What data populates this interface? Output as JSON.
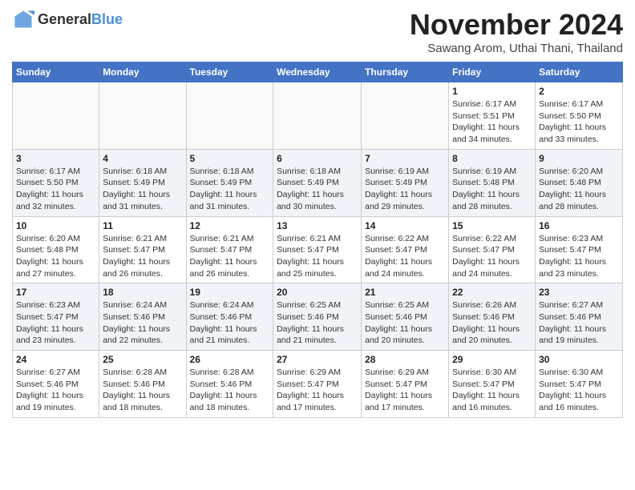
{
  "header": {
    "logo_general": "General",
    "logo_blue": "Blue",
    "month_title": "November 2024",
    "subtitle": "Sawang Arom, Uthai Thani, Thailand"
  },
  "days_of_week": [
    "Sunday",
    "Monday",
    "Tuesday",
    "Wednesday",
    "Thursday",
    "Friday",
    "Saturday"
  ],
  "weeks": [
    [
      {
        "day": "",
        "info": ""
      },
      {
        "day": "",
        "info": ""
      },
      {
        "day": "",
        "info": ""
      },
      {
        "day": "",
        "info": ""
      },
      {
        "day": "",
        "info": ""
      },
      {
        "day": "1",
        "info": "Sunrise: 6:17 AM\nSunset: 5:51 PM\nDaylight: 11 hours and 34 minutes."
      },
      {
        "day": "2",
        "info": "Sunrise: 6:17 AM\nSunset: 5:50 PM\nDaylight: 11 hours and 33 minutes."
      }
    ],
    [
      {
        "day": "3",
        "info": "Sunrise: 6:17 AM\nSunset: 5:50 PM\nDaylight: 11 hours and 32 minutes."
      },
      {
        "day": "4",
        "info": "Sunrise: 6:18 AM\nSunset: 5:49 PM\nDaylight: 11 hours and 31 minutes."
      },
      {
        "day": "5",
        "info": "Sunrise: 6:18 AM\nSunset: 5:49 PM\nDaylight: 11 hours and 31 minutes."
      },
      {
        "day": "6",
        "info": "Sunrise: 6:18 AM\nSunset: 5:49 PM\nDaylight: 11 hours and 30 minutes."
      },
      {
        "day": "7",
        "info": "Sunrise: 6:19 AM\nSunset: 5:49 PM\nDaylight: 11 hours and 29 minutes."
      },
      {
        "day": "8",
        "info": "Sunrise: 6:19 AM\nSunset: 5:48 PM\nDaylight: 11 hours and 28 minutes."
      },
      {
        "day": "9",
        "info": "Sunrise: 6:20 AM\nSunset: 5:48 PM\nDaylight: 11 hours and 28 minutes."
      }
    ],
    [
      {
        "day": "10",
        "info": "Sunrise: 6:20 AM\nSunset: 5:48 PM\nDaylight: 11 hours and 27 minutes."
      },
      {
        "day": "11",
        "info": "Sunrise: 6:21 AM\nSunset: 5:47 PM\nDaylight: 11 hours and 26 minutes."
      },
      {
        "day": "12",
        "info": "Sunrise: 6:21 AM\nSunset: 5:47 PM\nDaylight: 11 hours and 26 minutes."
      },
      {
        "day": "13",
        "info": "Sunrise: 6:21 AM\nSunset: 5:47 PM\nDaylight: 11 hours and 25 minutes."
      },
      {
        "day": "14",
        "info": "Sunrise: 6:22 AM\nSunset: 5:47 PM\nDaylight: 11 hours and 24 minutes."
      },
      {
        "day": "15",
        "info": "Sunrise: 6:22 AM\nSunset: 5:47 PM\nDaylight: 11 hours and 24 minutes."
      },
      {
        "day": "16",
        "info": "Sunrise: 6:23 AM\nSunset: 5:47 PM\nDaylight: 11 hours and 23 minutes."
      }
    ],
    [
      {
        "day": "17",
        "info": "Sunrise: 6:23 AM\nSunset: 5:47 PM\nDaylight: 11 hours and 23 minutes."
      },
      {
        "day": "18",
        "info": "Sunrise: 6:24 AM\nSunset: 5:46 PM\nDaylight: 11 hours and 22 minutes."
      },
      {
        "day": "19",
        "info": "Sunrise: 6:24 AM\nSunset: 5:46 PM\nDaylight: 11 hours and 21 minutes."
      },
      {
        "day": "20",
        "info": "Sunrise: 6:25 AM\nSunset: 5:46 PM\nDaylight: 11 hours and 21 minutes."
      },
      {
        "day": "21",
        "info": "Sunrise: 6:25 AM\nSunset: 5:46 PM\nDaylight: 11 hours and 20 minutes."
      },
      {
        "day": "22",
        "info": "Sunrise: 6:26 AM\nSunset: 5:46 PM\nDaylight: 11 hours and 20 minutes."
      },
      {
        "day": "23",
        "info": "Sunrise: 6:27 AM\nSunset: 5:46 PM\nDaylight: 11 hours and 19 minutes."
      }
    ],
    [
      {
        "day": "24",
        "info": "Sunrise: 6:27 AM\nSunset: 5:46 PM\nDaylight: 11 hours and 19 minutes."
      },
      {
        "day": "25",
        "info": "Sunrise: 6:28 AM\nSunset: 5:46 PM\nDaylight: 11 hours and 18 minutes."
      },
      {
        "day": "26",
        "info": "Sunrise: 6:28 AM\nSunset: 5:46 PM\nDaylight: 11 hours and 18 minutes."
      },
      {
        "day": "27",
        "info": "Sunrise: 6:29 AM\nSunset: 5:47 PM\nDaylight: 11 hours and 17 minutes."
      },
      {
        "day": "28",
        "info": "Sunrise: 6:29 AM\nSunset: 5:47 PM\nDaylight: 11 hours and 17 minutes."
      },
      {
        "day": "29",
        "info": "Sunrise: 6:30 AM\nSunset: 5:47 PM\nDaylight: 11 hours and 16 minutes."
      },
      {
        "day": "30",
        "info": "Sunrise: 6:30 AM\nSunset: 5:47 PM\nDaylight: 11 hours and 16 minutes."
      }
    ]
  ]
}
